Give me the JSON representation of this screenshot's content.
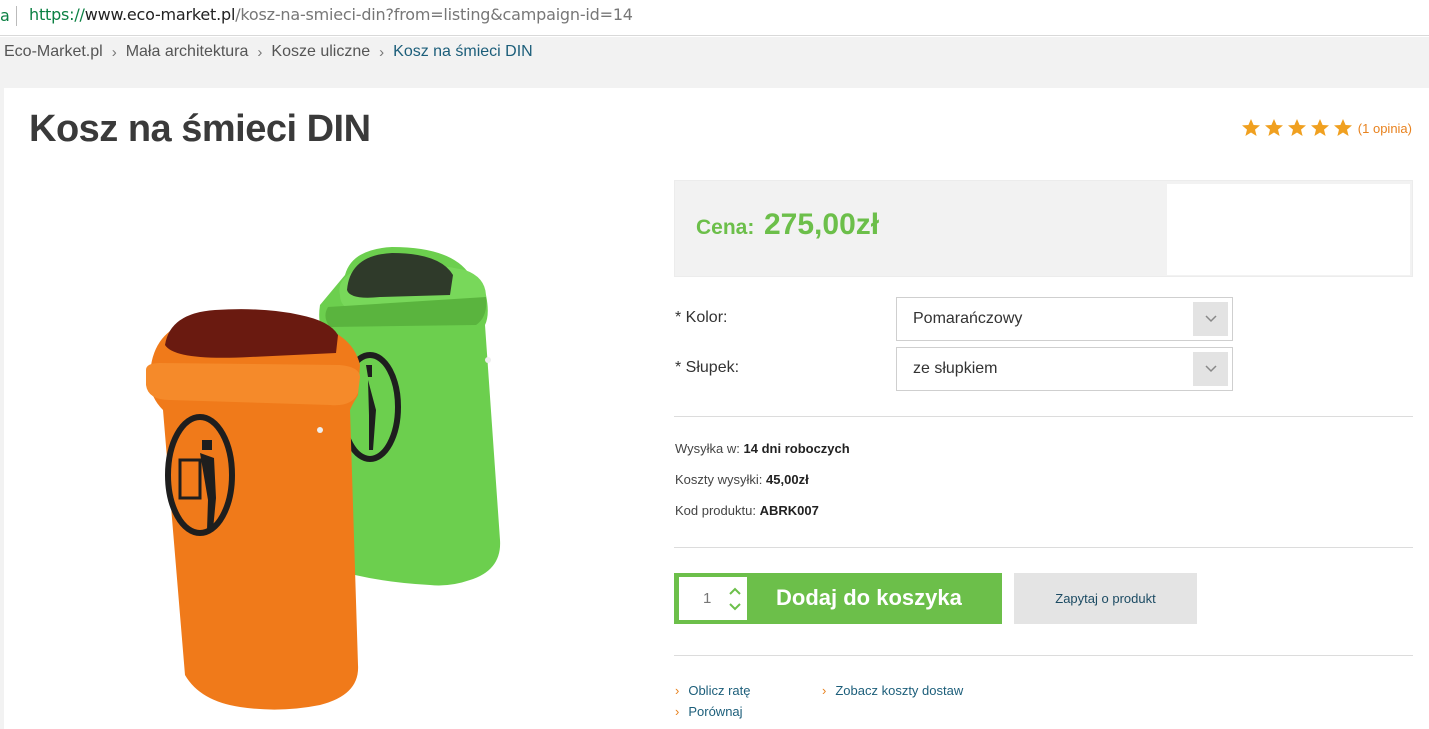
{
  "browser": {
    "tab_fragment": "a",
    "url": {
      "scheme": "https://",
      "host": "www.eco-market.pl",
      "path": "/kosz-na-smieci-din?from=listing&campaign-id=14"
    }
  },
  "breadcrumb": [
    "Eco-Market.pl",
    "Mała architektura",
    "Kosze uliczne",
    "Kosz na śmieci DIN"
  ],
  "product": {
    "title": "Kosz na śmieci DIN",
    "rating": {
      "stars": 5,
      "max": 5,
      "count_label": "(1 opinia)"
    },
    "price_label": "Cena:",
    "price_value": "275,00zł",
    "options": [
      {
        "label": "* Kolor:",
        "value": "Pomarańczowy"
      },
      {
        "label": "* Słupek:",
        "value": "ze słupkiem"
      }
    ],
    "shipping": {
      "time_label": "Wysyłka w:",
      "time_value": "14 dni roboczych",
      "cost_label": "Koszty wysyłki:",
      "cost_value": "45,00zł",
      "code_label": "Kod produktu:",
      "code_value": "ABRK007"
    },
    "quantity": "1",
    "add_to_cart_label": "Dodaj do koszyka",
    "ask_label": "Zapytaj o produkt",
    "links": {
      "installment": "Oblicz ratę",
      "compare": "Porównaj",
      "delivery_costs": "Zobacz koszty dostaw"
    }
  },
  "colors": {
    "accent_green": "#6cbf4a",
    "star_orange": "#f0a020",
    "link_blue": "#1c5e7a",
    "bin_orange": "#f07a1a",
    "bin_green": "#6ccf4e"
  }
}
